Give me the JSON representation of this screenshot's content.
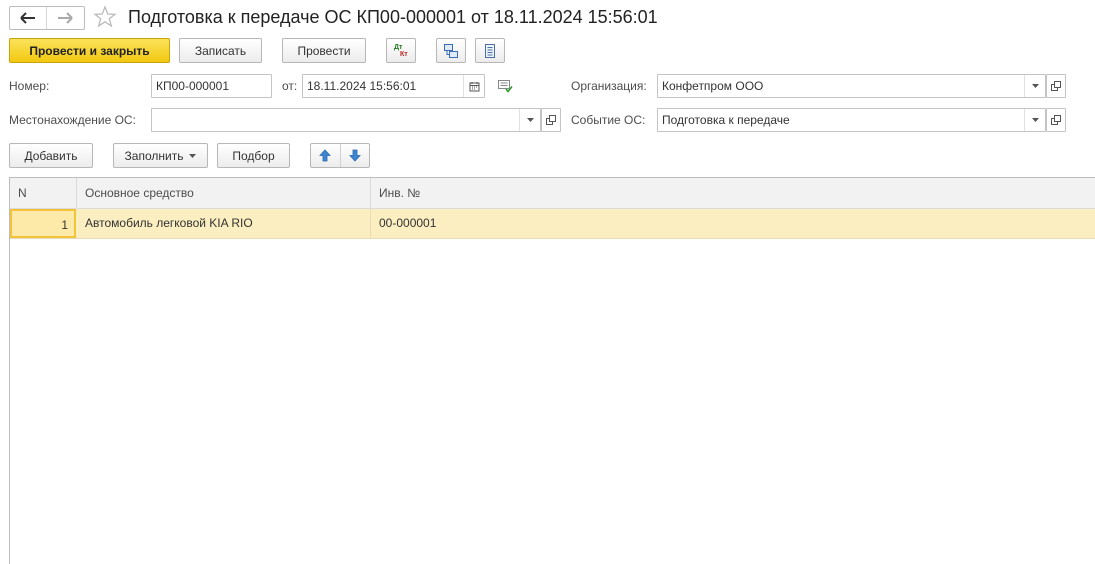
{
  "window": {
    "title": "Подготовка к передаче ОС КП00-000001 от 18.11.2024 15:56:01"
  },
  "toolbar": {
    "post_and_close": "Провести и закрыть",
    "save": "Записать",
    "post": "Провести",
    "dt_kt_top": "Дт",
    "dt_kt_bottom": "Кт"
  },
  "form": {
    "number_label": "Номер:",
    "number_value": "КП00-000001",
    "date_label": "от:",
    "date_value": "18.11.2024 15:56:01",
    "org_label": "Организация:",
    "org_value": "Конфетпром ООО",
    "location_label": "Местонахождение ОС:",
    "location_value": "",
    "event_label": "Событие ОС:",
    "event_value": "Подготовка к передаче"
  },
  "table_toolbar": {
    "add": "Добавить",
    "fill": "Заполнить",
    "select": "Подбор"
  },
  "table": {
    "columns": [
      "N",
      "Основное средство",
      "Инв. №"
    ],
    "rows": [
      {
        "n": "1",
        "asset": "Автомобиль легковой KIA RIO",
        "inv": "00-000001"
      }
    ]
  },
  "colors": {
    "primary_button": "#f2c811",
    "selected_row": "#fbeec0",
    "current_cell_border": "#f3c33a"
  }
}
